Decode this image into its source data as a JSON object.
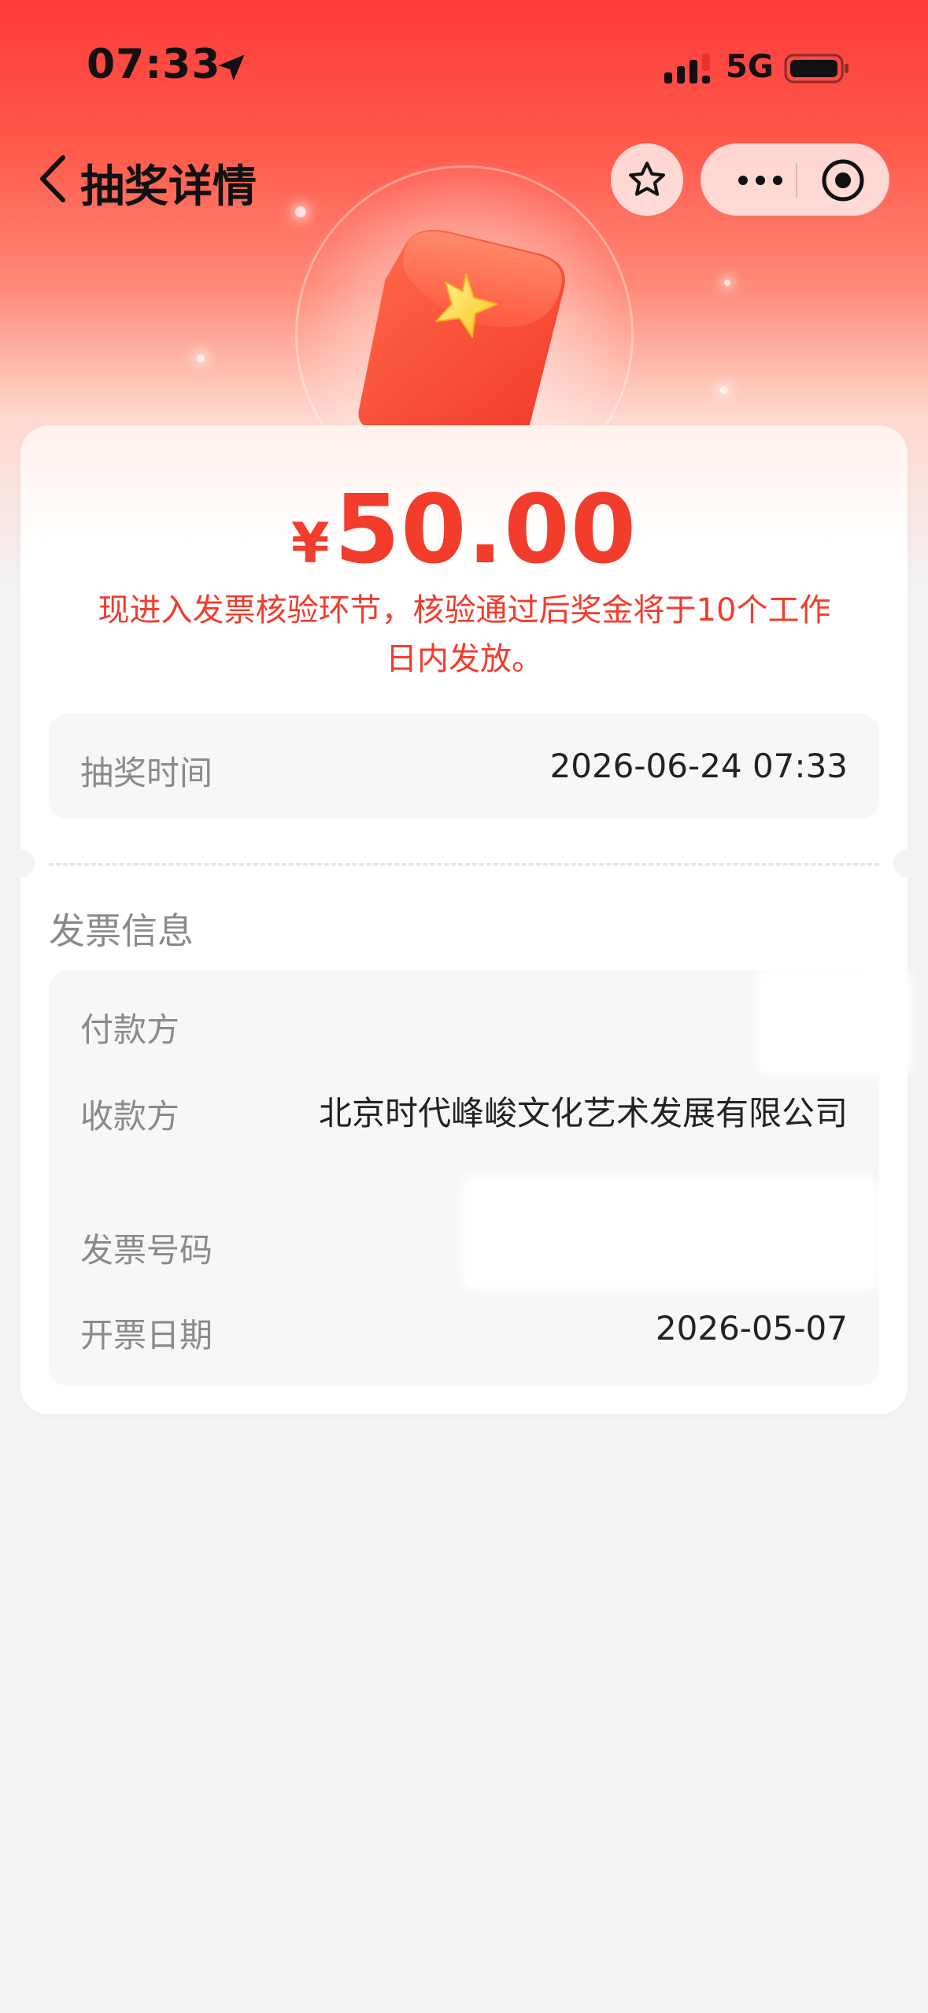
{
  "status_bar": {
    "time": "07:33",
    "network": "5G",
    "location_icon": "location-arrow-icon",
    "signal_icon": "cellular-signal-icon",
    "battery_icon": "battery-icon"
  },
  "nav": {
    "title": "抽奖详情",
    "back_icon": "chevron-left-icon",
    "favorite_icon": "star-icon",
    "more_icon": "more-dots-icon",
    "close_icon": "target-close-icon"
  },
  "prize": {
    "currency": "¥",
    "amount": "50.00",
    "notice": "现进入发票核验环节，核验通过后奖金将于10个工作日内发放。",
    "illustration": "red-envelope-star"
  },
  "draw": {
    "label": "抽奖时间",
    "value": "2026-06-24 07:33"
  },
  "invoice": {
    "section_title": "发票信息",
    "payer_label": "付款方",
    "payer_value": "",
    "payee_label": "收款方",
    "payee_value": "北京时代峰峻文化艺术发展有限公司",
    "number_label": "发票号码",
    "number_value": "",
    "date_label": "开票日期",
    "date_value": "2026-05-07"
  },
  "colors": {
    "accent_red": "#f23c2c",
    "header_red": "#ff3b3b",
    "page_bg": "#f2f3f5",
    "label_gray": "#8a8a8a"
  }
}
